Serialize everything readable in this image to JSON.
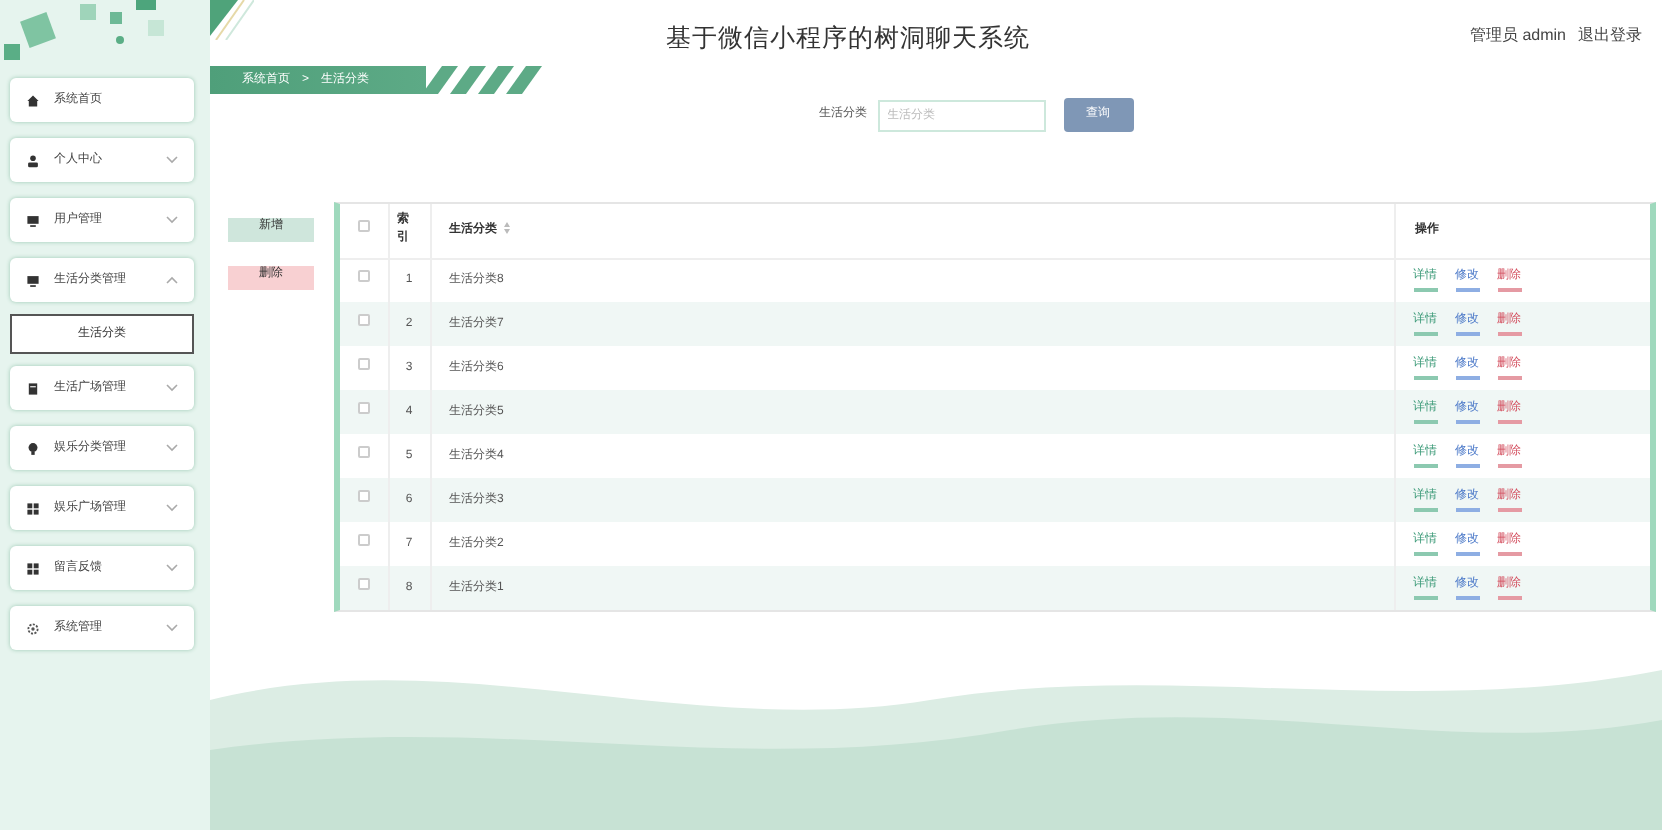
{
  "header": {
    "title": "基于微信小程序的树洞聊天系统",
    "user": "管理员 admin",
    "logout": "退出登录"
  },
  "sidebar": {
    "items": [
      {
        "label": "系统首页"
      },
      {
        "label": "个人中心",
        "expanded": false
      },
      {
        "label": "用户管理",
        "expanded": false
      },
      {
        "label": "生活分类管理",
        "expanded": true,
        "children": [
          {
            "label": "生活分类",
            "selected": true
          }
        ]
      },
      {
        "label": "生活广场管理",
        "expanded": false
      },
      {
        "label": "娱乐分类管理",
        "expanded": false
      },
      {
        "label": "娱乐广场管理",
        "expanded": false
      },
      {
        "label": "留言反馈",
        "expanded": false
      },
      {
        "label": "系统管理",
        "expanded": false
      }
    ]
  },
  "breadcrumb": {
    "items": [
      "系统首页",
      "生活分类"
    ],
    "separator": ">"
  },
  "search": {
    "label": "生活分类",
    "placeholder": "生活分类",
    "button": "查询"
  },
  "actions": [
    {
      "label": "新增",
      "kind": "add"
    },
    {
      "label": "删除",
      "kind": "delete"
    }
  ],
  "table": {
    "columns": [
      "索引",
      "生活分类",
      "操作"
    ],
    "all_checked": false,
    "rows": [
      {
        "index": "1",
        "name": "生活分类8",
        "checked": false,
        "actions": [
          {
            "label": "详情",
            "kind": "detail"
          },
          {
            "label": "修改",
            "kind": "edit"
          },
          {
            "label": "删除",
            "kind": "delete"
          }
        ]
      },
      {
        "index": "2",
        "name": "生活分类7",
        "checked": false,
        "actions": [
          {
            "label": "详情",
            "kind": "detail"
          },
          {
            "label": "修改",
            "kind": "edit"
          },
          {
            "label": "删除",
            "kind": "delete"
          }
        ]
      },
      {
        "index": "3",
        "name": "生活分类6",
        "checked": false,
        "actions": [
          {
            "label": "详情",
            "kind": "detail"
          },
          {
            "label": "修改",
            "kind": "edit"
          },
          {
            "label": "删除",
            "kind": "delete"
          }
        ]
      },
      {
        "index": "4",
        "name": "生活分类5",
        "checked": false,
        "actions": [
          {
            "label": "详情",
            "kind": "detail"
          },
          {
            "label": "修改",
            "kind": "edit"
          },
          {
            "label": "删除",
            "kind": "delete"
          }
        ]
      },
      {
        "index": "5",
        "name": "生活分类4",
        "checked": false,
        "actions": [
          {
            "label": "详情",
            "kind": "detail"
          },
          {
            "label": "修改",
            "kind": "edit"
          },
          {
            "label": "删除",
            "kind": "delete"
          }
        ]
      },
      {
        "index": "6",
        "name": "生活分类3",
        "checked": false,
        "actions": [
          {
            "label": "详情",
            "kind": "detail"
          },
          {
            "label": "修改",
            "kind": "edit"
          },
          {
            "label": "删除",
            "kind": "delete"
          }
        ]
      },
      {
        "index": "7",
        "name": "生活分类2",
        "checked": false,
        "actions": [
          {
            "label": "详情",
            "kind": "detail"
          },
          {
            "label": "修改",
            "kind": "edit"
          },
          {
            "label": "删除",
            "kind": "delete"
          }
        ]
      },
      {
        "index": "8",
        "name": "生活分类1",
        "checked": false,
        "actions": [
          {
            "label": "详情",
            "kind": "detail"
          },
          {
            "label": "修改",
            "kind": "edit"
          },
          {
            "label": "删除",
            "kind": "delete"
          }
        ]
      }
    ]
  }
}
